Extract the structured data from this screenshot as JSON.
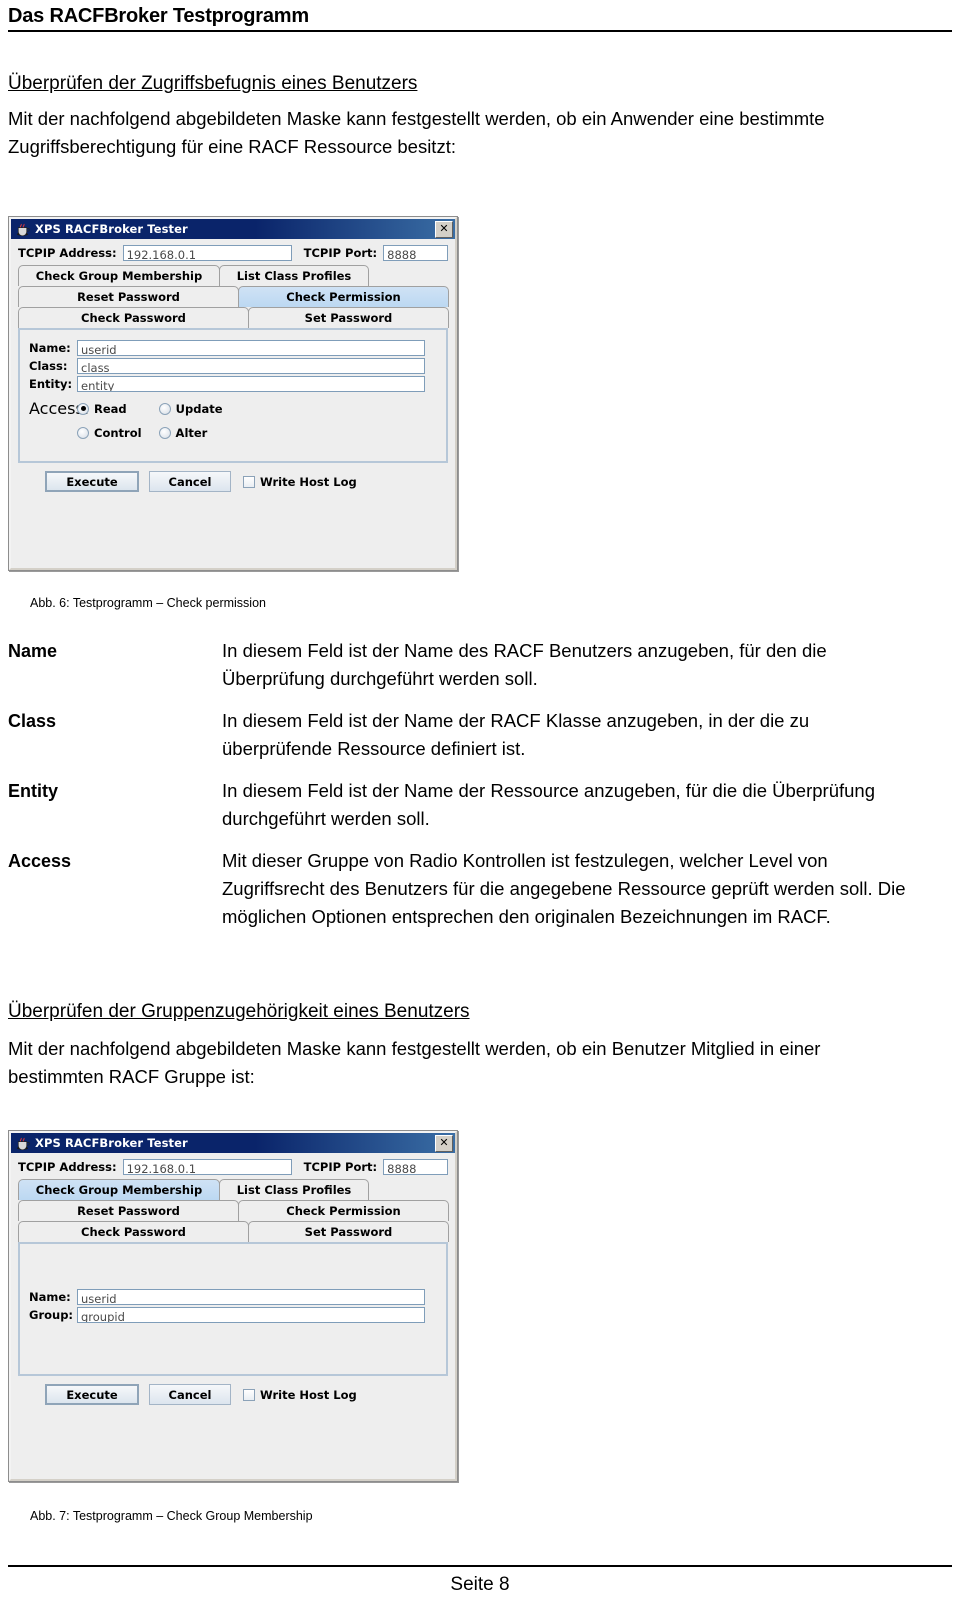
{
  "header": {
    "title": "Das RACFBroker Testprogramm"
  },
  "sections": [
    {
      "heading": "Überprüfen der Zugriffsbefugnis eines Benutzers",
      "intro": "Mit der nachfolgend abgebildeten Maske kann festgestellt werden, ob ein Anwender eine bestimmte Zugriffsberechtigung für eine RACF Ressource besitzt:",
      "caption": "Abb. 6: Testprogramm – Check permission"
    },
    {
      "heading": "Überprüfen der Gruppenzugehörigkeit eines Benutzers",
      "intro": "Mit der nachfolgend abgebildeten Maske kann festgestellt werden, ob ein Benutzer Mitglied in einer bestimmten RACF Gruppe ist:",
      "caption": "Abb. 7: Testprogramm – Check Group Membership"
    }
  ],
  "definitions": [
    {
      "term": "Name",
      "desc": "In diesem Feld ist der Name des RACF Benutzers anzugeben, für den die Überprüfung durchgeführt werden soll."
    },
    {
      "term": "Class",
      "desc": "In diesem Feld ist der Name der RACF Klasse anzugeben, in der die zu überprüfende Ressource definiert ist."
    },
    {
      "term": "Entity",
      "desc": "In diesem Feld ist der Name der Ressource anzugeben, für die die Überprüfung durchgeführt werden soll."
    },
    {
      "term": "Access",
      "desc": "Mit dieser Gruppe von Radio Kontrollen ist festzulegen, welcher Level von Zugriffsrecht des Benutzers für die angegebene Ressource geprüft werden soll. Die möglichen Optionen entsprechen den originalen Bezeichnungen im RACF."
    }
  ],
  "dialog1": {
    "window_title": "XPS RACFBroker Tester",
    "close_label": "✕",
    "address_label": "TCPIP Address:",
    "address_value": "192.168.0.1",
    "port_label": "TCPIP Port:",
    "port_value": "8888",
    "tabs": [
      {
        "label": "Check Group Membership",
        "selected": false
      },
      {
        "label": "List Class Profiles",
        "selected": false
      },
      {
        "label": "Reset Password",
        "selected": false
      },
      {
        "label": "Check Permission",
        "selected": true
      },
      {
        "label": "Check Password",
        "selected": false
      },
      {
        "label": "Set Password",
        "selected": false
      }
    ],
    "fields": [
      {
        "label": "Name:",
        "value": "userid"
      },
      {
        "label": "Class:",
        "value": "class"
      },
      {
        "label": "Entity:",
        "value": "entity"
      }
    ],
    "access_label": "Access:",
    "access_options": [
      {
        "label": "Read",
        "selected": true
      },
      {
        "label": "Update",
        "selected": false
      },
      {
        "label": "Control",
        "selected": false
      },
      {
        "label": "Alter",
        "selected": false
      }
    ],
    "execute_label": "Execute",
    "cancel_label": "Cancel",
    "writelog_label": "Write Host Log",
    "writelog_checked": false
  },
  "dialog2": {
    "window_title": "XPS RACFBroker Tester",
    "close_label": "✕",
    "address_label": "TCPIP Address:",
    "address_value": "192.168.0.1",
    "port_label": "TCPIP Port:",
    "port_value": "8888",
    "tabs": [
      {
        "label": "Check Group Membership",
        "selected": true
      },
      {
        "label": "List Class Profiles",
        "selected": false
      },
      {
        "label": "Reset Password",
        "selected": false
      },
      {
        "label": "Check Permission",
        "selected": false
      },
      {
        "label": "Check Password",
        "selected": false
      },
      {
        "label": "Set Password",
        "selected": false
      }
    ],
    "fields": [
      {
        "label": "Name:",
        "value": "userid"
      },
      {
        "label": "Group:",
        "value": "groupid"
      }
    ],
    "execute_label": "Execute",
    "cancel_label": "Cancel",
    "writelog_label": "Write Host Log",
    "writelog_checked": false
  },
  "footer": {
    "page_label": "Seite 8"
  }
}
